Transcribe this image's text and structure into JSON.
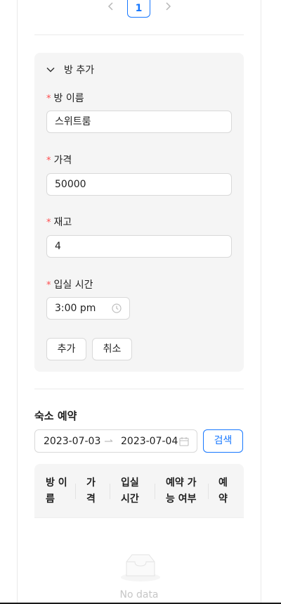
{
  "pagination": {
    "current_page": "1"
  },
  "add_room": {
    "title": "방 추가",
    "fields": {
      "name": {
        "label": "방 이름",
        "value": "스위트룸"
      },
      "price": {
        "label": "가격",
        "value": "50000"
      },
      "stock": {
        "label": "재고",
        "value": "4"
      },
      "checkin": {
        "label": "입실 시간",
        "value": "3:00 pm"
      }
    },
    "add_button": "추가",
    "cancel_button": "취소"
  },
  "reservation": {
    "title": "숙소 예약",
    "start_date": "2023-07-03",
    "end_date": "2023-07-04",
    "search_button": "검색",
    "columns": [
      "방 이름",
      "가격",
      "입실 시간",
      "예약 가능 여부",
      "예약"
    ],
    "empty_text": "No data"
  },
  "colors": {
    "primary": "#1677ff",
    "required": "#ff4d4f",
    "panel_bg": "#f5f5f5"
  }
}
